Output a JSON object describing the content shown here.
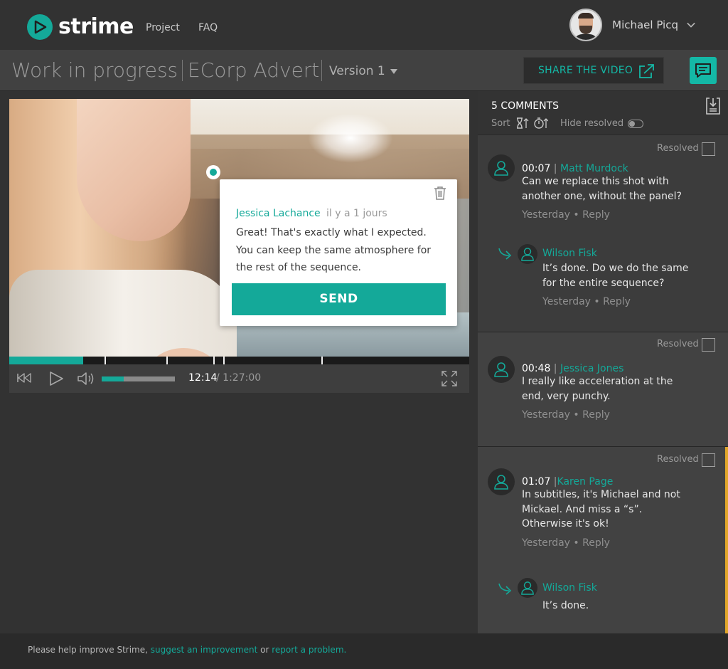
{
  "brand": {
    "name": "strime",
    "accent": "#14a999"
  },
  "nav": {
    "project": "Project",
    "faq": "FAQ"
  },
  "user": {
    "name": "Michael Picq"
  },
  "title": {
    "status": "Work in progress",
    "project": "ECorp Advert",
    "version": "Version 1"
  },
  "share": {
    "label": "SHARE THE VIDEO"
  },
  "popup": {
    "author": "Jessica Lachance",
    "time": "il y a 1 jours",
    "text": "Great! That's exactly what I expected. You can keep the same atmosphere for the rest of the sequence.",
    "send_label": "SEND"
  },
  "player": {
    "current_time": "12:14",
    "total_time": "/ 1:27:00",
    "progress": 0.16,
    "volume": 0.3
  },
  "comments_panel": {
    "count_label": "5 COMMENTS",
    "sort_label": "Sort",
    "hide_resolved_label": "Hide resolved",
    "resolved_label": "Resolved",
    "yesterday": "Yesterday",
    "reply": "Reply",
    "threads": [
      {
        "time": "00:07",
        "sep": " | ",
        "author": "Matt Murdock",
        "text": "Can we replace this shot with another one, without the panel?",
        "reply": {
          "author": "Wilson Fisk",
          "text": "It’s done. Do we do the same for the entire sequence?"
        }
      },
      {
        "time": "00:48",
        "sep": " | ",
        "author": "Jessica Jones",
        "text": "I really like acceleration at the end, very punchy."
      },
      {
        "time": "01:07",
        "sep": " |",
        "author": "Karen Page",
        "text": "In subtitles, it's Michael and not Mickael. And miss a “s”. Otherwise it's ok!",
        "reply": {
          "author": "Wilson Fisk",
          "text": "It’s done."
        }
      }
    ]
  },
  "footer": {
    "prefix": "Please help improve Strime, ",
    "suggest": "suggest an improvement",
    "or": " or ",
    "report": "report a problem."
  }
}
